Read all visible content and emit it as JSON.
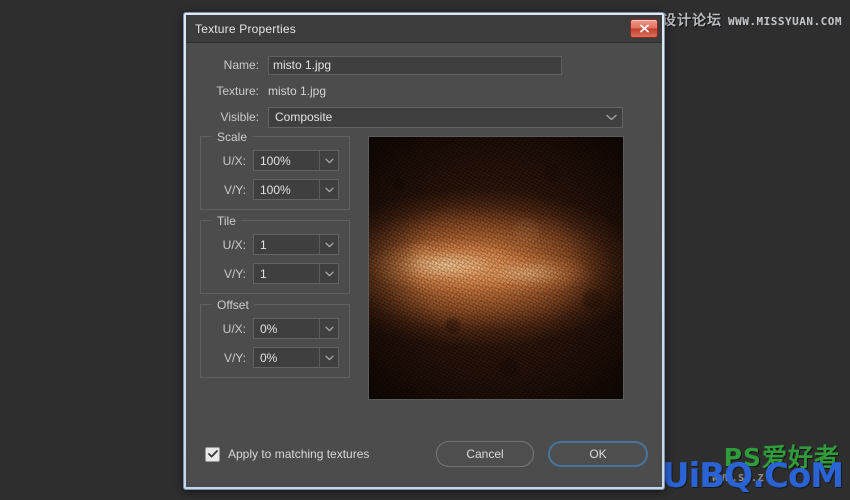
{
  "window": {
    "title": "Texture Properties",
    "close_icon": "close-icon"
  },
  "fields": {
    "name_label": "Name:",
    "name_value": "misto 1.jpg",
    "texture_label": "Texture:",
    "texture_value": "misto 1.jpg",
    "visible_label": "Visible:",
    "visible_value": "Composite"
  },
  "groups": [
    {
      "legend": "Scale",
      "ux_label": "U/X:",
      "ux_value": "100%",
      "vy_label": "V/Y:",
      "vy_value": "100%"
    },
    {
      "legend": "Tile",
      "ux_label": "U/X:",
      "ux_value": "1",
      "vy_label": "V/Y:",
      "vy_value": "1"
    },
    {
      "legend": "Offset",
      "ux_label": "U/X:",
      "ux_value": "0%",
      "vy_label": "V/Y:",
      "vy_value": "0%"
    }
  ],
  "preview": {
    "alt": "texture-preview",
    "colors": {
      "highlight": "#f0a262",
      "mid": "#8a4a22",
      "shadow": "#2b1308"
    }
  },
  "footer": {
    "checkbox_label": "Apply to matching textures",
    "checkbox_checked": true,
    "cancel_label": "Cancel",
    "ok_label": "OK"
  },
  "colors": {
    "dialog_bg": "#4c4c4c",
    "desktop_bg": "#2e2e2e",
    "titlebar_bg": "#3c3c3c",
    "accent_focus": "#46749e",
    "close_red": "#c5402c"
  },
  "watermarks": {
    "top_cn": "思缘设计论坛",
    "top_url": "WWW.MISSYUAN.COM",
    "bottom_logo": "PS爱好者",
    "bottom_brand": "UiBQ.CoM",
    "bottom_sub": "WWW.SA.Z"
  }
}
